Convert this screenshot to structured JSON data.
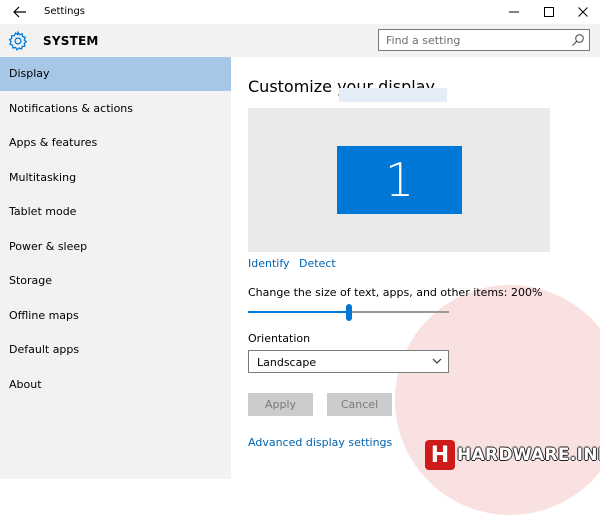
{
  "window": {
    "title": "Settings",
    "back_icon": "back-arrow-icon",
    "minimize_icon": "minimize-icon",
    "maximize_icon": "maximize-icon",
    "close_icon": "close-icon"
  },
  "header": {
    "title": "SYSTEM",
    "icon": "gear-icon",
    "search_placeholder": "Find a setting"
  },
  "sidebar": {
    "items": [
      {
        "label": "Display",
        "active": true
      },
      {
        "label": "Notifications & actions",
        "active": false
      },
      {
        "label": "Apps & features",
        "active": false
      },
      {
        "label": "Multitasking",
        "active": false
      },
      {
        "label": "Tablet mode",
        "active": false
      },
      {
        "label": "Power & sleep",
        "active": false
      },
      {
        "label": "Storage",
        "active": false
      },
      {
        "label": "Offline maps",
        "active": false
      },
      {
        "label": "Default apps",
        "active": false
      },
      {
        "label": "About",
        "active": false
      }
    ]
  },
  "main": {
    "title": "Customize your display",
    "monitor_number": "1",
    "identify_label": "Identify",
    "detect_label": "Detect",
    "scale_label": "Change the size of text, apps, and other items: 200%",
    "scale_percent": 200,
    "slider_fraction": 0.5,
    "orientation_label": "Orientation",
    "orientation_value": "Landscape",
    "apply_label": "Apply",
    "cancel_label": "Cancel",
    "advanced_link": "Advanced display settings"
  },
  "watermark": {
    "text": "HARDWARE.INFO",
    "icon_letter": "H"
  },
  "colors": {
    "accent": "#0078d7",
    "link": "#0063b1",
    "sidebar_bg": "#f2f2f2",
    "selected_bg": "#a6c8e6",
    "brand_red": "#cf1a1a"
  }
}
